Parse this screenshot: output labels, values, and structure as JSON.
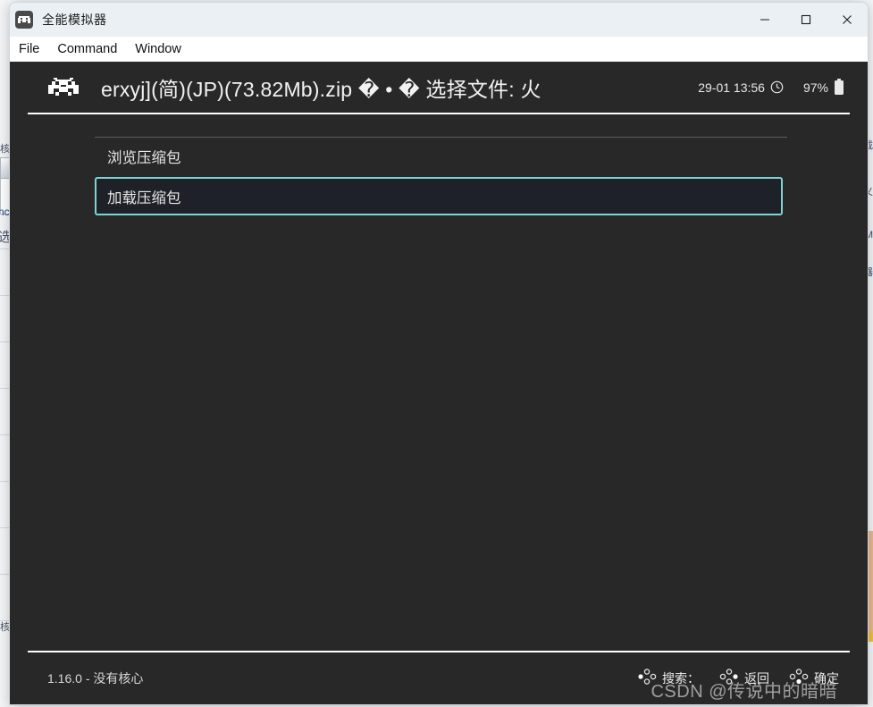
{
  "window": {
    "title": "全能模拟器",
    "icon": "gamepad-invader-icon",
    "controls": {
      "minimize": "minimize-icon",
      "maximize": "maximize-icon",
      "close": "close-icon"
    }
  },
  "menubar": {
    "items": [
      {
        "label": "File"
      },
      {
        "label": "Command"
      },
      {
        "label": "Window"
      }
    ]
  },
  "header": {
    "icon": "space-invader-icon",
    "title": "erxyj](简)(JP)(73.82Mb).zip � • � 选择文件: 火",
    "clock": "29-01 13:56",
    "clock_icon": "clock-icon",
    "battery_percent": "97%",
    "battery_icon": "battery-icon"
  },
  "menu_list": {
    "items": [
      {
        "label": "浏览压缩包",
        "selected": false
      },
      {
        "label": "加载压缩包",
        "selected": true
      }
    ]
  },
  "footer": {
    "version": "1.16.0 - 没有核心",
    "hints": [
      {
        "icon": "gamepad-button-left-icon",
        "label": "搜索："
      },
      {
        "icon": "gamepad-button-right-icon",
        "label": "返回"
      },
      {
        "icon": "gamepad-button-down-icon",
        "label": "确定"
      }
    ]
  },
  "watermark": {
    "text": "CSDN @传说中的暗暗"
  },
  "colors": {
    "canvas_bg": "#282828",
    "titlebar_bg": "#eaf0f4",
    "selection_border": "#7fd4d4",
    "selection_fill": "#1f2128",
    "rule": "#ffffff"
  }
}
